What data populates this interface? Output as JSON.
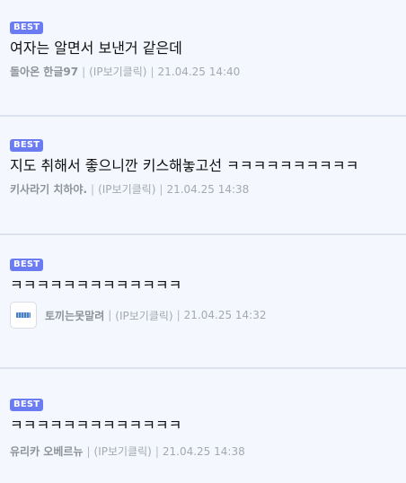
{
  "comments": [
    {
      "badge": "BEST",
      "text": "여자는 알면서 보낸거 같은데",
      "nickname": "돌아온 한글97",
      "ip_label": "(IP보기클릭)",
      "date": "21.04.25 14:40",
      "separator": "|"
    },
    {
      "badge": "BEST",
      "text": "지도 취해서 좋으니깐 키스해놓고선 ㅋㅋㅋㅋㅋㅋㅋㅋㅋㅋ",
      "nickname": "키사라기 치하야.",
      "ip_label": "(IP보기클릭)",
      "date": "21.04.25 14:38",
      "separator": "|"
    },
    {
      "badge": "BEST",
      "text": "ㅋㅋㅋㅋㅋㅋㅋㅋㅋㅋㅋㅋㅋ",
      "nickname": "토끼는못말려",
      "ip_label": "(IP보기클릭)",
      "date": "21.04.25 14:32",
      "separator": "|",
      "avatar_icon": "user-avatar-icon"
    },
    {
      "badge": "BEST",
      "text": "ㅋㅋㅋㅋㅋㅋㅋㅋㅋㅋㅋㅋㅋ",
      "nickname": "유리카 오베르뉴",
      "ip_label": "(IP보기클릭)",
      "date": "21.04.25 14:38",
      "separator": "|"
    }
  ],
  "colors": {
    "badge_bg": "#6b7cf2",
    "page_bg": "#f4f7fd",
    "divider": "#dde3ee",
    "meta_text": "#a3a8b3"
  }
}
